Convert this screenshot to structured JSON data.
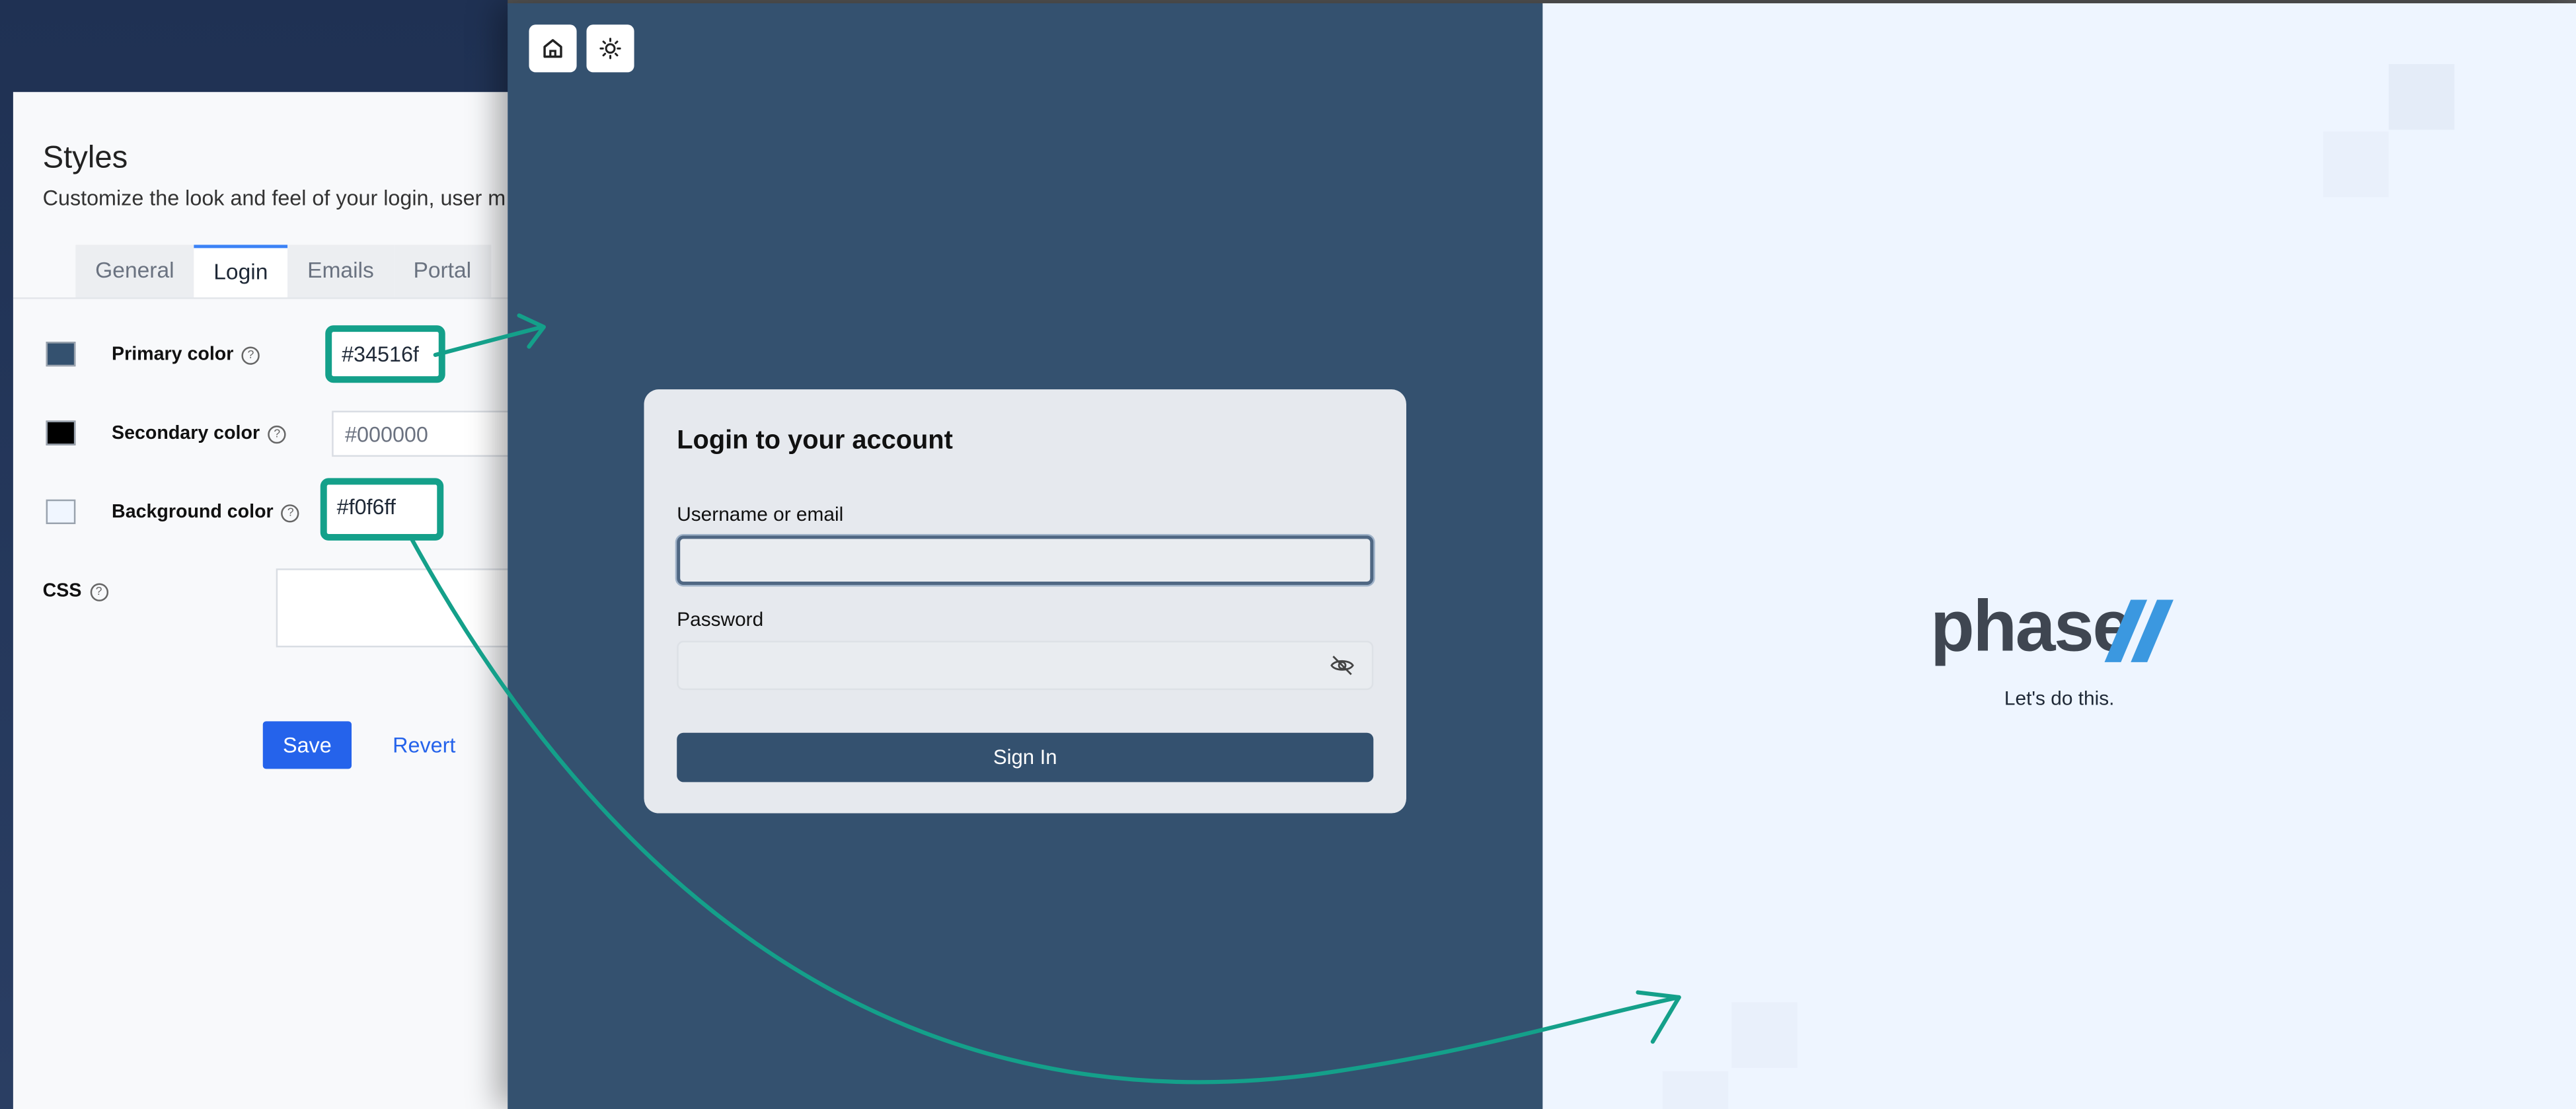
{
  "settings": {
    "title": "Styles",
    "subtitle": "Customize the look and feel of your login, user m",
    "tabs": [
      {
        "label": "General"
      },
      {
        "label": "Login"
      },
      {
        "label": "Emails"
      },
      {
        "label": "Portal"
      }
    ],
    "active_tab": "Login",
    "colors": [
      {
        "label": "Primary color",
        "value": "#34516f",
        "swatch": "#34516f"
      },
      {
        "label": "Secondary color",
        "value": "#000000",
        "swatch": "#000000"
      },
      {
        "label": "Background color",
        "value": "#f0f6ff",
        "swatch": "#f0f6ff"
      }
    ],
    "css_label": "CSS",
    "help_glyph": "?",
    "save_label": "Save",
    "revert_label": "Revert"
  },
  "login": {
    "card_title": "Login to your account",
    "username_label": "Username or email",
    "username_value": "",
    "password_label": "Password",
    "password_value": "",
    "signin_label": "Sign In",
    "icons": [
      "home-icon",
      "sun-icon",
      "eye-off-icon"
    ]
  },
  "brand": {
    "logo_text": "phase",
    "tagline": "Let's do this."
  },
  "theme": {
    "primary": "#34516f",
    "background": "#eef5ff",
    "accent": "#2563eb",
    "annotation": "#14a08a"
  }
}
